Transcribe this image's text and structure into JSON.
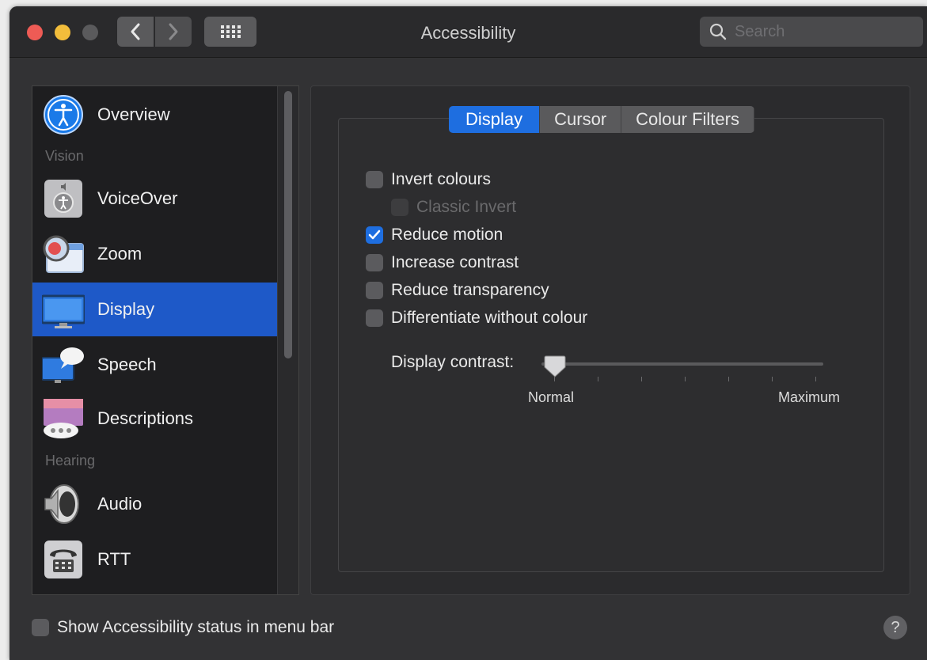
{
  "window": {
    "title": "Accessibility"
  },
  "search": {
    "placeholder": "Search"
  },
  "sidebar": {
    "items": [
      {
        "label": "Overview",
        "selected": false
      },
      {
        "label": "VoiceOver",
        "selected": false
      },
      {
        "label": "Zoom",
        "selected": false
      },
      {
        "label": "Display",
        "selected": true
      },
      {
        "label": "Speech",
        "selected": false
      },
      {
        "label": "Descriptions",
        "selected": false
      },
      {
        "label": "Audio",
        "selected": false
      },
      {
        "label": "RTT",
        "selected": false
      }
    ],
    "categories": {
      "vision": "Vision",
      "hearing": "Hearing"
    }
  },
  "tabs": [
    {
      "label": "Display",
      "active": true
    },
    {
      "label": "Cursor",
      "active": false
    },
    {
      "label": "Colour Filters",
      "active": false
    }
  ],
  "options": {
    "invert_colours": {
      "label": "Invert colours",
      "checked": false
    },
    "classic_invert": {
      "label": "Classic Invert",
      "checked": false,
      "enabled": false
    },
    "reduce_motion": {
      "label": "Reduce motion",
      "checked": true
    },
    "increase_contrast": {
      "label": "Increase contrast",
      "checked": false
    },
    "reduce_transparency": {
      "label": "Reduce transparency",
      "checked": false
    },
    "differentiate": {
      "label": "Differentiate without colour",
      "checked": false
    }
  },
  "display_contrast": {
    "label": "Display contrast:",
    "min_label": "Normal",
    "max_label": "Maximum",
    "value": 0
  },
  "footer": {
    "status_label": "Show Accessibility status in menu bar",
    "status_checked": false,
    "help_label": "?"
  },
  "colors": {
    "accent": "#1e6ee0",
    "selection": "#1e59c8",
    "window_bg": "#323234"
  },
  "icons": {
    "nav_back": "chevron-left-icon",
    "nav_fwd": "chevron-right-icon",
    "grid": "grid-icon",
    "search": "search-icon"
  }
}
